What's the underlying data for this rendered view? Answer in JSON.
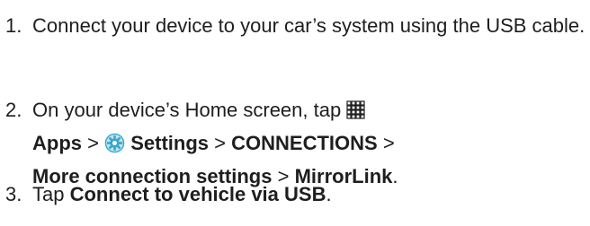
{
  "steps": [
    {
      "number": "1.",
      "text": "Connect your device to your car’s system using the USB cable."
    },
    {
      "number": "2.",
      "intro": "On your device’s Home screen, tap",
      "apps_icon": "apps-grid-icon",
      "apps": "Apps",
      "sep": ">",
      "settings_icon": "settings-gear-icon",
      "settings": "Settings",
      "connections": "CONNECTIONS",
      "more": "More connection settings",
      "mirrorlink": "MirrorLink",
      "period": "."
    },
    {
      "number": "3.",
      "tap": "Tap",
      "action": "Connect to vehicle via USB",
      "period": "."
    }
  ],
  "colors": {
    "text": "#1e1e1e",
    "settings_icon": "#3aa6c9"
  }
}
